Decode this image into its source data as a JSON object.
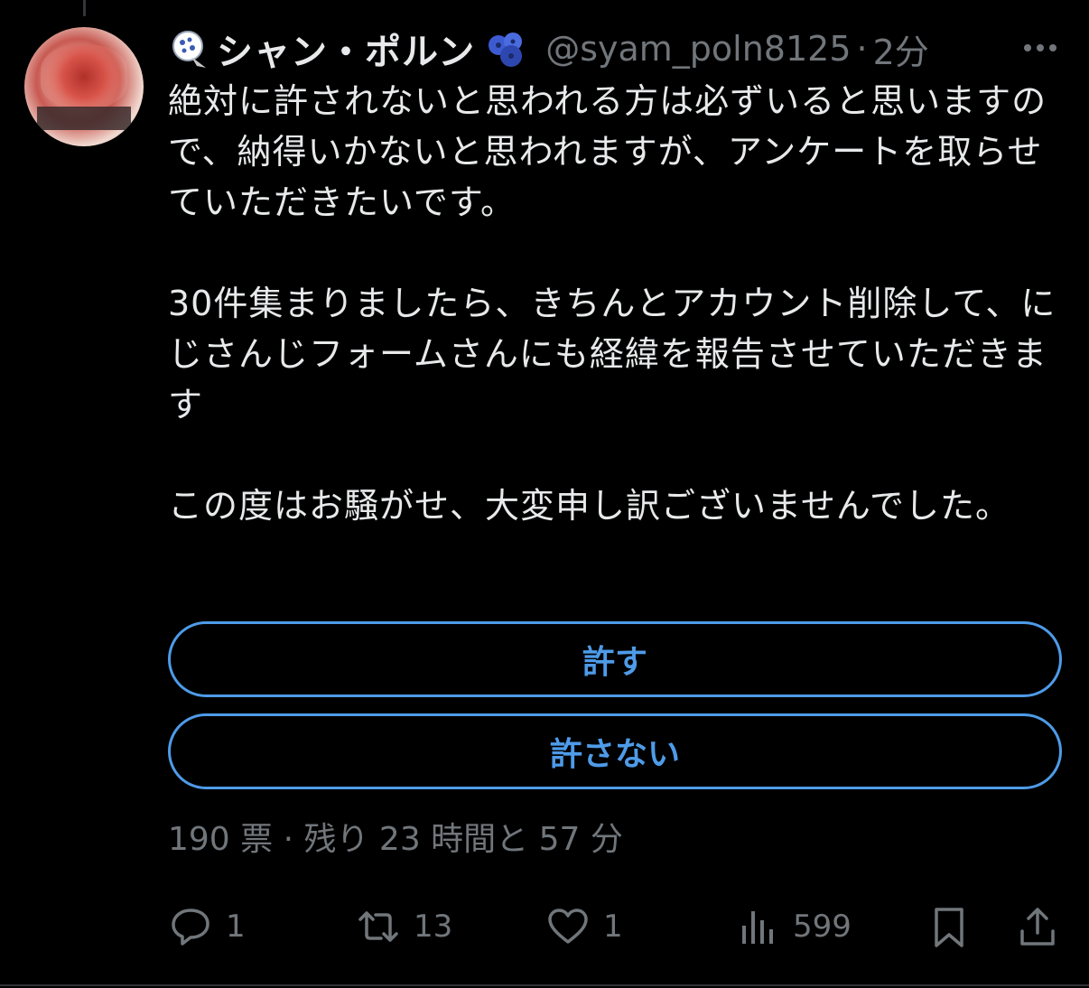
{
  "author": {
    "display_name": "シャン・ポルン",
    "handle": "@syam_poln8125",
    "separator": "·",
    "time": "2分"
  },
  "tweet": {
    "text": "絶対に許されないと思われる方は必ずいると思いますので、納得いかないと思われますが、アンケートを取らせていただきたいです。\n\n30件集まりましたら、きちんとアカウント削除して、にじさんじフォームさんにも経緯を報告させていただきます\n\nこの度はお騒がせ、大変申し訳ございませんでした。"
  },
  "poll": {
    "options": [
      {
        "label": "許す"
      },
      {
        "label": "許さない"
      }
    ],
    "meta": "190 票 · 残り 23 時間と 57 分"
  },
  "actions": {
    "reply_count": "1",
    "retweet_count": "13",
    "like_count": "1",
    "view_count": "599"
  },
  "icons": {
    "name_deco": "badge-icon",
    "name_emoji": "blueberries-icon",
    "more": "more-horizontal-icon",
    "reply": "reply-icon",
    "retweet": "retweet-icon",
    "like": "heart-icon",
    "views": "views-icon",
    "bookmark": "bookmark-icon",
    "share": "share-icon"
  },
  "colors": {
    "background": "#000000",
    "text": "#e7e9ea",
    "muted": "#71767b",
    "accent": "#4e9be8"
  }
}
